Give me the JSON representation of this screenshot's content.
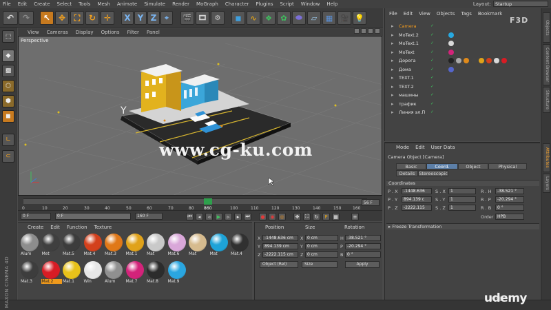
{
  "menubar": {
    "items": [
      "File",
      "Edit",
      "Create",
      "Select",
      "Tools",
      "Mesh",
      "Animate",
      "Simulate",
      "Render",
      "MoGraph",
      "Character",
      "Plugins",
      "Script",
      "Window",
      "Help"
    ],
    "layout_label": "Layout:",
    "layout_value": "Startup"
  },
  "toolbar": {
    "axis_x": "X",
    "axis_y": "Y",
    "axis_z": "Z"
  },
  "viewport": {
    "menu": [
      "View",
      "Cameras",
      "Display",
      "Options",
      "Filter",
      "Panel"
    ],
    "label": "Perspective"
  },
  "watermark": "www.cg-ku.com",
  "timeline": {
    "ticks": [
      "0",
      "10",
      "20",
      "30",
      "40",
      "50",
      "60",
      "70",
      "80",
      "90",
      "100",
      "110",
      "120",
      "130",
      "140",
      "150",
      "160"
    ],
    "current_frame_marker": "860",
    "frame_display": "56 F"
  },
  "transport": {
    "start_field": "0 F",
    "min_field": "0 F",
    "max_field": "160 F",
    "end_field": "160 F"
  },
  "materials": {
    "menu": [
      "Create",
      "Edit",
      "Function",
      "Texture"
    ],
    "row1": [
      {
        "label": "Alum",
        "color": "#8d8d8d"
      },
      {
        "label": "Met",
        "color": "#3f3f3f"
      },
      {
        "label": "Mat.5",
        "color": "#3c3c3c"
      },
      {
        "label": "Mat.4",
        "color": "#d3401c"
      },
      {
        "label": "Mat.3",
        "color": "#e07818"
      },
      {
        "label": "Mat.1",
        "color": "#e0a21a"
      },
      {
        "label": "Mat",
        "color": "#c9c9c9"
      },
      {
        "label": "Mat.6",
        "color": "#d9a7d9"
      },
      {
        "label": "Mat",
        "color": "#d6bb8e"
      },
      {
        "label": "Mat",
        "color": "#1ea3d8"
      },
      {
        "label": "Mat.4",
        "color": "#303030"
      }
    ],
    "row2": [
      {
        "label": "Mat.3",
        "color": "#3d3d3d",
        "selected": false
      },
      {
        "label": "Mat.2",
        "color": "#d81c24",
        "selected": true
      },
      {
        "label": "Mat.1",
        "color": "#e8c21a",
        "selected": false
      },
      {
        "label": "Win",
        "color": "#e6e6e6",
        "selected": false
      },
      {
        "label": "Alum",
        "color": "#909090",
        "selected": false
      },
      {
        "label": "Mat.7",
        "color": "#d3237a",
        "selected": false
      },
      {
        "label": "Mat.8",
        "color": "#2c2c2c",
        "selected": false
      },
      {
        "label": "Mat.9",
        "color": "#2aa6e0",
        "selected": false
      }
    ]
  },
  "coordinates": {
    "headers": [
      "Position",
      "Size",
      "Rotation"
    ],
    "rows": [
      {
        "axis": "X",
        "pos": "-1448.636 cm",
        "size_axis": "X",
        "size": "0 cm",
        "rot_axis": "H",
        "rot": "-38.521 °"
      },
      {
        "axis": "Y",
        "pos": "894.139 cm",
        "size_axis": "Y",
        "size": "0 cm",
        "rot_axis": "P",
        "rot": "-20.294 °"
      },
      {
        "axis": "Z",
        "pos": "-2222.115 cm",
        "size_axis": "Z",
        "size": "0 cm",
        "rot_axis": "B",
        "rot": "0 °"
      }
    ],
    "mode_select": "Object (Rel)",
    "size_select": "Size",
    "apply_label": "Apply"
  },
  "objects": {
    "menu": [
      "File",
      "Edit",
      "View",
      "Objects",
      "Tags",
      "Bookmark"
    ],
    "brand": "F3D",
    "rows": [
      {
        "name": "Camera",
        "highlight": true,
        "tags": []
      },
      {
        "name": "MoText.2",
        "highlight": false,
        "tags": [
          "#27a9e1"
        ]
      },
      {
        "name": "MoText.1",
        "highlight": false,
        "tags": [
          "#d9d9d9"
        ]
      },
      {
        "name": "MoText",
        "highlight": false,
        "tags": [
          "#d3237a"
        ]
      },
      {
        "name": "Дорога",
        "highlight": false,
        "tags": [
          "#222222",
          "#aaaaaa",
          "#e08a1a",
          "#444444",
          "#e0a21a",
          "#d3401c",
          "#d9d9d9",
          "#d81c24"
        ]
      },
      {
        "name": "Дома",
        "highlight": false,
        "tags": [
          "#5566cc"
        ]
      },
      {
        "name": "TEXT.1",
        "highlight": false,
        "tags": []
      },
      {
        "name": "TEXT.2",
        "highlight": false,
        "tags": []
      },
      {
        "name": "машины",
        "highlight": false,
        "tags": []
      },
      {
        "name": "трафик",
        "highlight": false,
        "tags": []
      },
      {
        "name": "Линия эл.П",
        "highlight": false,
        "tags": []
      }
    ]
  },
  "attributes": {
    "menu": [
      "Mode",
      "Edit",
      "User Data"
    ],
    "title": "Camera Object [Camera]",
    "tabs_row1": [
      "Basic",
      "Coord.",
      "Object",
      "Physical"
    ],
    "tabs_row2": [
      "Details",
      "Stereoscopic"
    ],
    "active_tab": "Coord.",
    "section_coordinates": "Coordinates",
    "section_freeze": "▸ Freeze Transformation",
    "rows": [
      {
        "p": "P . X",
        "pv": "-1448.636",
        "s": "S . X",
        "sv": "1",
        "r": "R . H",
        "rv": "-38.521 °"
      },
      {
        "p": "P . Y",
        "pv": "894.139 c",
        "s": "S . Y",
        "sv": "1",
        "r": "R . P",
        "rv": "-20.294 °"
      },
      {
        "p": "P . Z",
        "pv": "-2222.115",
        "s": "S . Z",
        "sv": "1",
        "r": "R . B",
        "rv": "0 °"
      }
    ],
    "order_label": "Order",
    "order_value": "HPB"
  },
  "sidetabs": [
    "Objects",
    "Content Browser",
    "Structure",
    "Attributes",
    "Layers"
  ],
  "branding": {
    "maxon": "MAXON CINEMA 4D",
    "udemy": "udemy",
    "f3d_small": "F3D"
  }
}
